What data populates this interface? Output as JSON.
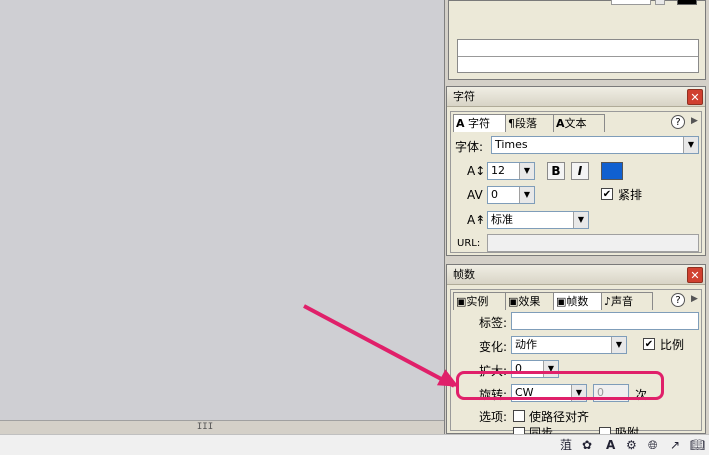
{
  "status_icons": [
    "stamp-icon",
    "palette-icon",
    "A",
    "gear-icon",
    "globe-icon",
    "arrow-icon",
    "book-icon"
  ],
  "top_panel": {},
  "char_panel": {
    "title": "字符",
    "tabs": [
      "字符",
      "段落",
      "文本"
    ],
    "font_label": "字体:",
    "font_value": "Times",
    "size_value": "12",
    "spacing_value": "0",
    "bold": "B",
    "italic": "I",
    "color": "#1060d0",
    "kern_label": "紧排",
    "kern_checked": "✔",
    "baseline_value": "标准",
    "url_label": "URL:"
  },
  "frame_panel": {
    "title": "帧数",
    "tabs": [
      "实例",
      "效果",
      "帧数",
      "声音"
    ],
    "label_label": "标签:",
    "tween_label": "变化:",
    "tween_value": "动作",
    "scale_label": "比例",
    "scale_checked": "✔",
    "ease_label": "扩大:",
    "ease_value": "0",
    "rotate_label": "旋转:",
    "rotate_value": "CW",
    "rotate_times": "0",
    "times_label": "次",
    "options_label": "选项:",
    "orient_label": "使路径对齐",
    "sync_label": "同步",
    "snap_label": "吸附"
  },
  "scroll_thumb": "III",
  "colors": {
    "accent": "#e0206a"
  }
}
